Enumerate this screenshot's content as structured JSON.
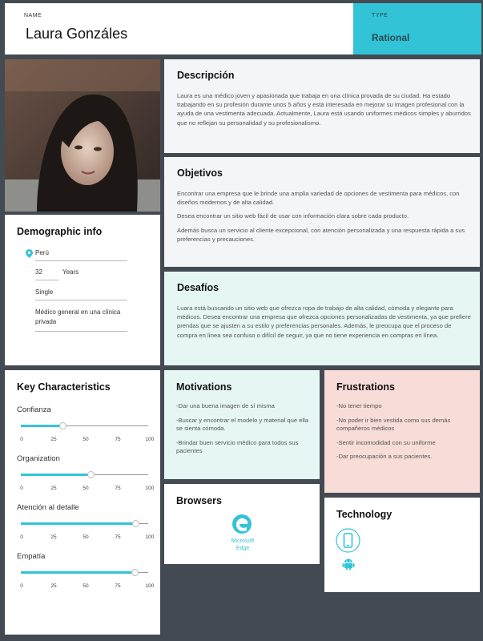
{
  "header": {
    "name_label": "NAME",
    "name": "Laura Gonzáles",
    "type_label": "TYPE",
    "type": "Rational"
  },
  "demographic": {
    "title": "Demographic info",
    "location": "Perú",
    "age": "32",
    "age_unit": "Years",
    "status": "Single",
    "occupation": "Médico general en una clínica privada"
  },
  "description": {
    "title": "Descripción",
    "text": "Laura es una médico joven y apasionada que trabaja en una clínica provada de su ciudad. Ha estado trabajando en su profesión durante unos 5 años y está interesada en mejorar su imagen profesional con la ayuda de una vestimenta adecuada. Actualmente, Laura está usando uniformes médicos simples y aburridos que no reflejan su personalidad y su profesionalismo."
  },
  "objectives": {
    "title": "Objetivos",
    "paragraphs": [
      "Encontrar una empresa que le brinde una amplia variedad de opciones de vestimenta para médicos, con diseños modernos y de alta calidad.",
      "Desea encontrar un sitio web fácil de usar con información clara sobre cada producto.",
      "Además busca un servicio al cliente excepcional, con atención personalizada y una respuesta rápida a sus preferencias y precauciones."
    ]
  },
  "challenges": {
    "title": "Desafíos",
    "text": "Luara está buscando un sitio web que ofrezca ropa de trabajo de alta calidad, cómoda y elegante para médicos. Desea encontrar una empresa que ofrezca opciones personalizadas de vestimenta, ya que prefiere prendas que se ajusten a su estilo y preferencias personales. Además, le preocupa que el proceso de compra en línea sea confuso o difícil de seguir, ya que no tiene experiencia en compras en línea."
  },
  "key_characteristics": {
    "title": "Key Characteristics",
    "ticks": [
      "0",
      "25",
      "50",
      "75",
      "100"
    ],
    "accent_color": "#33c3d6",
    "sliders": [
      {
        "label": "Confianza",
        "value": 33
      },
      {
        "label": "Organization",
        "value": 55
      },
      {
        "label": "Atención al detalle",
        "value": 90
      },
      {
        "label": "Empatía",
        "value": 89
      }
    ]
  },
  "motivations": {
    "title": "Motivations",
    "items": [
      "-Dar una buena imagen de sí misma",
      "-Buscar y encontrar el modelo y material que ella se sienta cómoda.",
      "-Brindar buen servicio médico para todos sus pacientes"
    ]
  },
  "frustrations": {
    "title": "Frustrations",
    "items": [
      "-No tener tiempo",
      "-No poder ir bien vestida como sus demás compañeros médicos",
      "-Sentir incomodidad con su uniforme",
      "-Dar preocupación a sus pacientes."
    ]
  },
  "browsers": {
    "title": "Browsers",
    "edge_label": "Microsoft Edge",
    "icon": "edge-icon"
  },
  "technology": {
    "title": "Technology",
    "icons": [
      "smartphone-icon",
      "android-icon"
    ]
  },
  "colors": {
    "accent": "#33c3d6",
    "background": "#434a52",
    "mint": "#e6f7f3",
    "pink": "#f8dcd7"
  }
}
